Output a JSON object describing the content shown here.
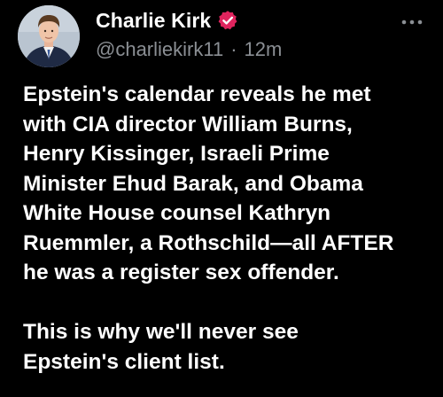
{
  "author": {
    "display_name": "Charlie Kirk",
    "handle": "@charliekirk11",
    "separator": "·",
    "time_ago": "12m",
    "verified": true
  },
  "colors": {
    "background": "#000000",
    "text": "#ffffff",
    "muted": "#8b8f94",
    "verified_badge": "#e0245e"
  },
  "icons": {
    "more": "more-horizontal-icon",
    "verified": "verified-badge-icon"
  },
  "tweet": {
    "paragraph1_lines": [
      "Epstein's calendar reveals he met",
      "with CIA director William Burns,",
      "Henry Kissinger, Israeli Prime",
      "Minister Ehud Barak, and Obama",
      "White House counsel Kathryn",
      "Ruemmler, a Rothschild—all AFTER",
      "he was a register sex offender."
    ],
    "paragraph2_lines": [
      "This is why we'll never see",
      "Epstein's client list."
    ]
  }
}
